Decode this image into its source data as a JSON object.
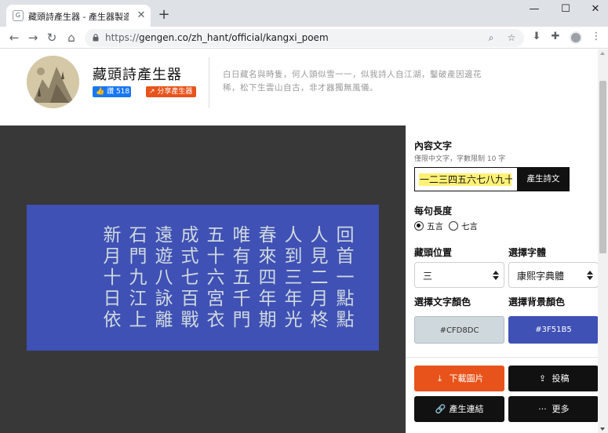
{
  "browser": {
    "tab_title": "藏頭詩產生器 - 產生器製造機⚡",
    "tab_favicon": "G",
    "url_scheme": "https://",
    "url_rest": "gengen.co/zh_hant/official/kangxi_poem"
  },
  "header": {
    "title": "藏頭詩產生器",
    "like_label": "讚 518",
    "share_label": "分享產生器",
    "tagline": "白日藏名與時隻，何人頭似雪一一，似我詩人自江湖，鑿破產因邊花稀，松下生雲山自古，非才器獨無風儀。"
  },
  "poem": {
    "columns": [
      "回首一點點",
      "人見二月柊",
      "人到三年光",
      "春來四年期",
      "唯有五千門",
      "五十六宮衣",
      "成式七百戰",
      "遠遊八詠離",
      "石門九江上",
      "新月十日依"
    ],
    "text_color": "#CFD8DC",
    "bg_color": "#3F51B5"
  },
  "panel": {
    "content_label": "內容文字",
    "content_hint": "僅限中文字，字數限制 10 字",
    "content_value": "一二三四五六七八九十",
    "generate_label": "產生詩文",
    "length_label": "每句長度",
    "length_options": [
      "五言",
      "七言"
    ],
    "position_label": "藏頭位置",
    "position_value": "三",
    "font_label": "選擇字體",
    "font_value": "康熙字典體",
    "text_color_label": "選擇文字顏色",
    "text_color_value": "#CFD8DC",
    "bg_color_label": "選擇背景顏色",
    "bg_color_value": "#3F51B5",
    "download_label": "下載圖片",
    "submit_label": "投稿",
    "link_label": "產生連結",
    "more_label": "更多"
  },
  "colors": {
    "accent_orange": "#E8531B",
    "facebook_blue": "#1877F2",
    "preview_bg": "#383838"
  }
}
